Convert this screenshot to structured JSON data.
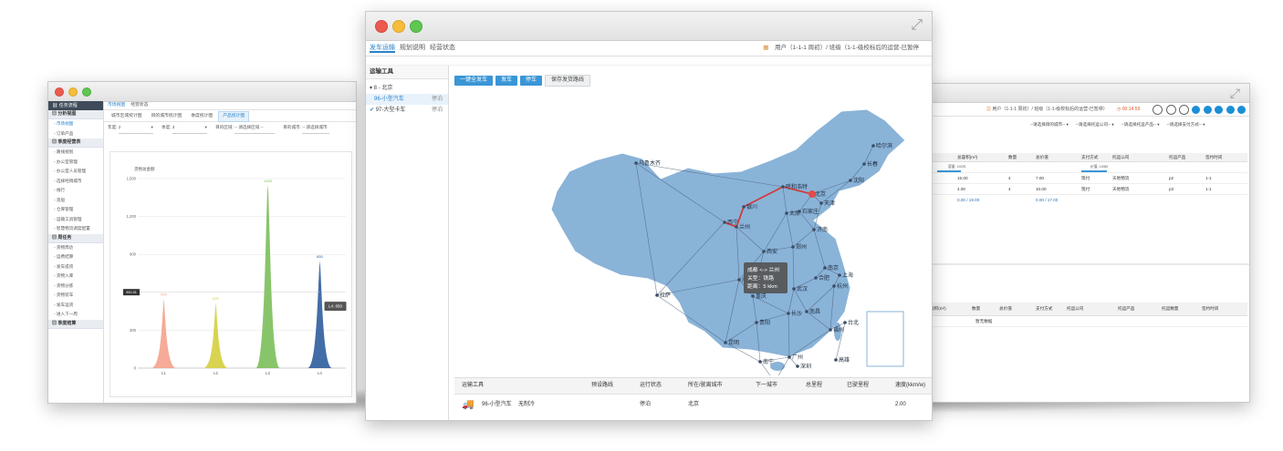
{
  "left_window": {
    "brand": "任务流程",
    "sidebar": [
      {
        "type": "section",
        "label": "分析视图"
      },
      {
        "type": "item",
        "label": "市场视图",
        "active": true
      },
      {
        "type": "item",
        "label": "订单产品"
      },
      {
        "type": "section",
        "label": "季度经营表"
      },
      {
        "type": "item",
        "label": "路线规划"
      },
      {
        "type": "item",
        "label": "办公室管理"
      },
      {
        "type": "item",
        "label": "办公室人员管理"
      },
      {
        "type": "item",
        "label": "选择经销城市"
      },
      {
        "type": "item",
        "label": "线行"
      },
      {
        "type": "item",
        "label": "货船"
      },
      {
        "type": "item",
        "label": "仓库管理"
      },
      {
        "type": "item",
        "label": "运输工具管理"
      },
      {
        "type": "item",
        "label": "智慧物流调度配置"
      },
      {
        "type": "section",
        "label": "周任务"
      },
      {
        "type": "item",
        "label": "货物周达"
      },
      {
        "type": "item",
        "label": "运费结算"
      },
      {
        "type": "item",
        "label": "发车提货"
      },
      {
        "type": "item",
        "label": "货物入库"
      },
      {
        "type": "item",
        "label": "货物分拣"
      },
      {
        "type": "item",
        "label": "货物装车"
      },
      {
        "type": "item",
        "label": "发车运货"
      },
      {
        "type": "item",
        "label": "进入下一周"
      },
      {
        "type": "section",
        "label": "季度结算"
      }
    ],
    "main_tabs": [
      {
        "label": "市场视图",
        "selected": true
      },
      {
        "label": "经营状态",
        "selected": false
      }
    ],
    "sub_tabs": [
      {
        "label": "城市区域统计图",
        "selected": false
      },
      {
        "label": "目的城市统计图",
        "selected": false
      },
      {
        "label": "季度统计图",
        "selected": false
      },
      {
        "label": "产品统计图",
        "selected": true
      }
    ],
    "filters": {
      "year_label": "年度:",
      "year_value": "2",
      "quarter_label": "季度:",
      "quarter_value": "3",
      "region_label": "目的区域:",
      "region_value": "-- 请选择区域 --",
      "city_label": "目的城市:",
      "city_value": "-- 请选择城市"
    },
    "chart_data": {
      "type": "area",
      "ylabel": "货物总金额",
      "categories": [
        "L1",
        "L2",
        "L3",
        "L4"
      ],
      "values": [
        550,
        520,
        1450,
        850
      ],
      "data_labels": [
        "550",
        "520",
        "1450",
        "850"
      ],
      "ylim": [
        0,
        1500
      ],
      "yticks": [
        0,
        300,
        600,
        900,
        1200,
        1500
      ],
      "ytick_labels": [
        "0",
        "300",
        "600",
        "900",
        "1,200",
        "1,500"
      ],
      "crosshair_label": "600.81",
      "tooltip": "L4: 850",
      "colors": [
        "#f4a28c",
        "#d4cf3e",
        "#7bbf5a",
        "#2f5d9c"
      ]
    }
  },
  "center_window": {
    "tabs": [
      {
        "label": "发车运输",
        "selected": true
      },
      {
        "label": "规划说明",
        "selected": false
      },
      {
        "label": "经营状态",
        "selected": false
      }
    ],
    "user_info": "用户（1-1-1 周初）/ 班级（1-1-级校标后的运营-已暂停",
    "sidebar_title": "运输工具",
    "tree_root": "▾ 8 - 北京",
    "vehicles": [
      {
        "mark": "",
        "name": "96-小型汽车",
        "status": "停泊",
        "highlight": true
      },
      {
        "mark": "✔",
        "name": "97-大型卡车",
        "status": "停泊",
        "highlight": false
      }
    ],
    "buttons": [
      {
        "label": "一键全发车",
        "style": "blue"
      },
      {
        "label": "发车",
        "style": "blue"
      },
      {
        "label": "停车",
        "style": "blue"
      },
      {
        "label": "保存发货路线",
        "style": "gray"
      }
    ],
    "map": {
      "cities": [
        "乌鲁木齐",
        "哈尔滨",
        "长春",
        "沈阳",
        "北京",
        "天津",
        "呼和浩特",
        "银川",
        "太原",
        "石家庄",
        "西宁",
        "兰州",
        "济南",
        "郑州",
        "西安",
        "拉萨",
        "成都",
        "重庆",
        "武汉",
        "合肥",
        "南京",
        "上海",
        "杭州",
        "长沙",
        "南昌",
        "福州",
        "贵阳",
        "昆明",
        "南宁",
        "广州",
        "深圳",
        "台北",
        "海口",
        "高雄"
      ],
      "tooltip_lines": [
        "成都 <-> 兰州",
        "关型：铁路",
        "距离：5 kkm"
      ]
    },
    "table": {
      "headers": [
        "运输工具",
        "预设路线",
        "运行状态",
        "所在/驶离城市",
        "下一城市",
        "总里程",
        "已驶里程",
        "速度(kkm/w)"
      ],
      "rows": [
        {
          "tool": "96-小型汽车",
          "route": "无制冷",
          "state": "停泊",
          "city": "北京",
          "next": "",
          "total": "",
          "done": "",
          "speed": "2.00"
        }
      ]
    }
  },
  "right_window": {
    "user_info": "用户（1-1-1 周初）/ 班级（1-1-级校标后的运营-已暂停）",
    "timer": "00:14:59",
    "filters": [
      "--请选择目的城市--",
      "--请选择托运公司--",
      "--请选择托运产品--",
      "--请选择支付方式--"
    ],
    "top_table": {
      "headers": [
        "总容积(m³)",
        "数量",
        "总价值",
        "支付方式",
        "托运公司",
        "托运产品",
        "签约时间"
      ],
      "progress_a": "容量: 10/25",
      "progress_b": "价值: 10/80",
      "rows": [
        [
          "15.00",
          "4",
          "7.00",
          "现付",
          "天地物流",
          "p2",
          "1-1"
        ],
        [
          "4.00",
          "4",
          "10.00",
          "现付",
          "天地物流",
          "p3",
          "1-1"
        ]
      ],
      "total_a": "0.00 / 19.00",
      "total_b": "0.00 / 17.00"
    },
    "bottom_table": {
      "headers": [
        "容积(m³)",
        "数量",
        "总价值",
        "支付方式",
        "托运公司",
        "托运产品",
        "托运数量",
        "签约时间"
      ],
      "empty_text": "暂无数据"
    }
  }
}
